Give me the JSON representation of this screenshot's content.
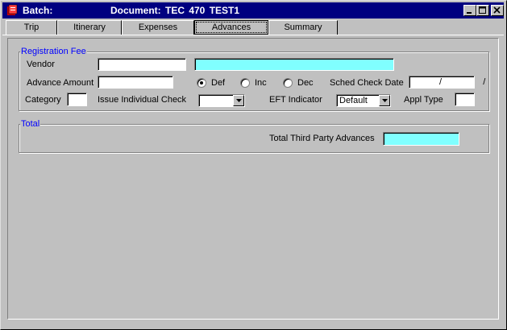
{
  "window": {
    "title_app": "Batch:",
    "title_doc": "Document:  TEC  470  TEST1"
  },
  "tabs": [
    {
      "label": "Trip",
      "active": false
    },
    {
      "label": "Itinerary",
      "active": false
    },
    {
      "label": "Expenses",
      "active": false
    },
    {
      "label": "Advances",
      "active": true
    },
    {
      "label": "Summary",
      "active": false
    }
  ],
  "registration": {
    "legend": "Registration Fee",
    "vendor_label": "Vendor",
    "vendor_code": "",
    "vendor_name": "",
    "advance_amount_label": "Advance Amount",
    "advance_amount": "",
    "radio_def": "Def",
    "radio_inc": "Inc",
    "radio_dec": "Dec",
    "selected_radio": "Def",
    "sched_check_date_label": "Sched Check Date",
    "sched_check_date": " /   /",
    "category_label": "Category",
    "category": "",
    "issue_individual_check_label": "Issue Individual Check",
    "issue_individual_check": "",
    "eft_indicator_label": "EFT Indicator",
    "eft_indicator": "Default",
    "appl_type_label": "Appl Type",
    "appl_type": ""
  },
  "total": {
    "legend": "Total",
    "third_party_label": "Total Third Party Advances",
    "third_party_value": ""
  },
  "colors": {
    "titlebar": "#000080",
    "legend_text": "#0000ff",
    "readonly_field": "#80ffff",
    "face": "#c0c0c0"
  }
}
